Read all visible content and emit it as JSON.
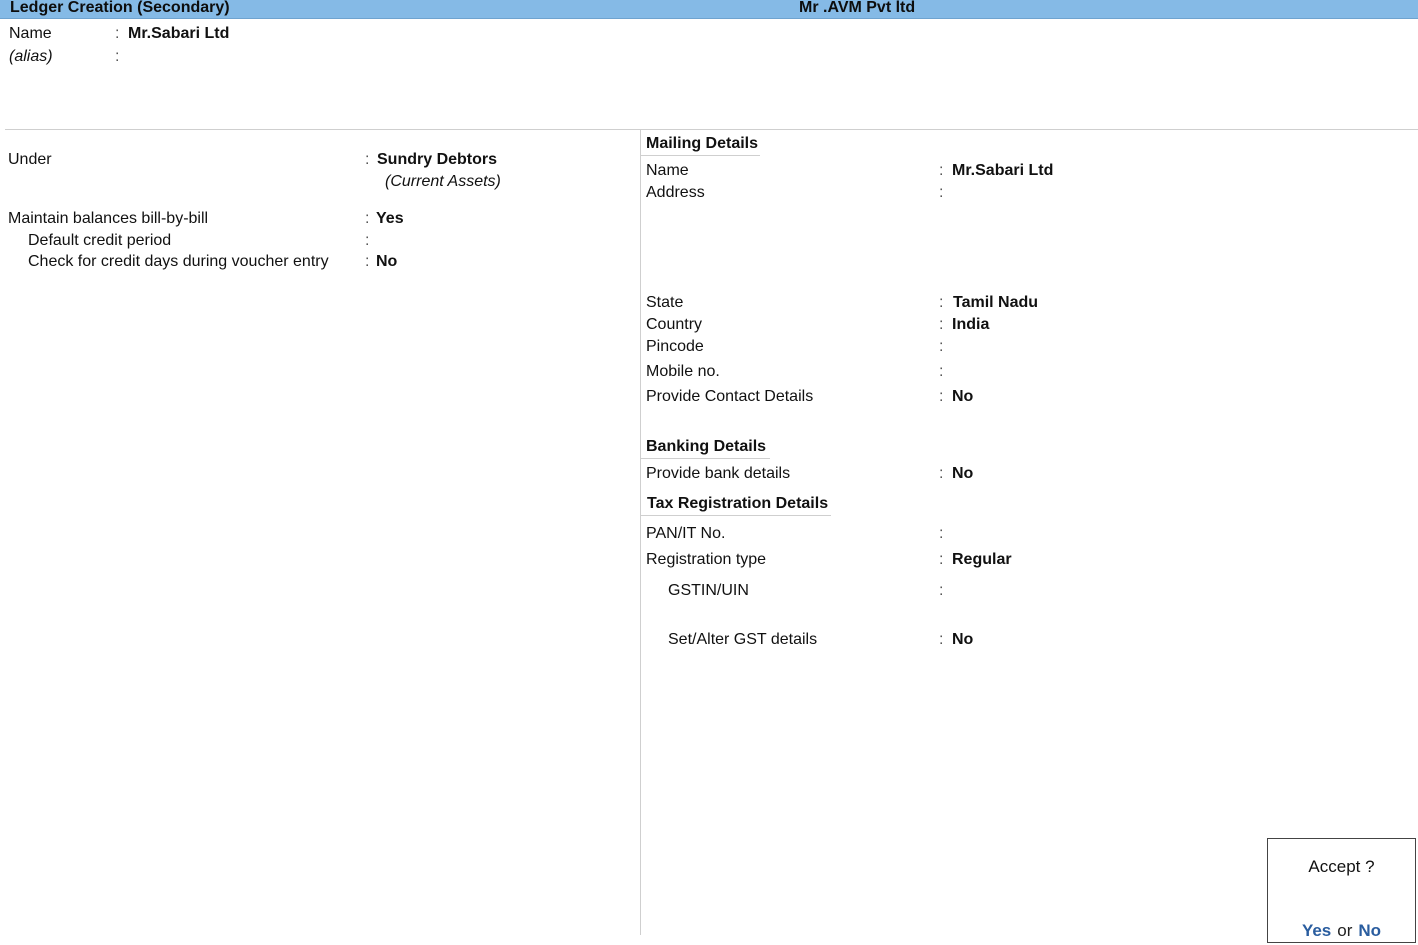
{
  "header": {
    "title": "Ledger Creation (Secondary)",
    "company": "Mr .AVM  Pvt ltd"
  },
  "top": {
    "name_label": "Name",
    "name_value": "Mr.Sabari Ltd",
    "alias_label": "(alias)",
    "alias_value": "",
    "colon": ":"
  },
  "left": {
    "under_label": "Under",
    "under_value": "Sundry Debtors",
    "under_group": "(Current Assets)",
    "bill_by_bill_label": "Maintain balances bill-by-bill",
    "bill_by_bill_value": "Yes",
    "credit_period_label": "Default credit period",
    "credit_period_value": "",
    "check_credit_label": "Check for credit days during voucher entry",
    "check_credit_value": "No"
  },
  "mailing": {
    "heading": "Mailing Details",
    "name_label": "Name",
    "name_value": "Mr.Sabari Ltd",
    "address_label": "Address",
    "address_value": "",
    "state_label": "State",
    "state_value": "Tamil Nadu",
    "country_label": "Country",
    "country_value": "India",
    "pincode_label": "Pincode",
    "pincode_value": "",
    "mobile_label": "Mobile no.",
    "mobile_value": "",
    "contact_label": "Provide Contact Details",
    "contact_value": "No"
  },
  "banking": {
    "heading": "Banking Details",
    "bank_label": "Provide bank details",
    "bank_value": "No"
  },
  "tax": {
    "heading": "Tax Registration Details",
    "pan_label": "PAN/IT No.",
    "pan_value": "",
    "regtype_label": "Registration type",
    "regtype_value": "Regular",
    "gstin_label": "GSTIN/UIN",
    "gstin_value": "",
    "gst_details_label": "Set/Alter GST details",
    "gst_details_value": "No"
  },
  "accept_dialog": {
    "question": "Accept ?",
    "yes": "Yes",
    "or": "or",
    "no": "No"
  },
  "colors": {
    "titlebar": "#85bae6",
    "accept_option": "#2a5d9f"
  }
}
